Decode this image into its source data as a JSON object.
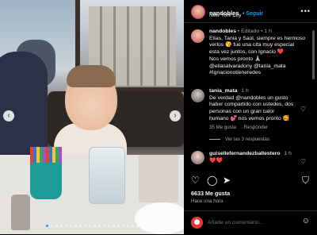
{
  "post": {
    "username": "nandobles",
    "follow_label": "Seguir",
    "location": "New York City",
    "more_label": "•••"
  },
  "comments": [
    {
      "user": "nandobles",
      "edited": "Editado",
      "age": "1 h",
      "text_lines": [
        "Elías, Tania y Saúl, siempre es hermoso",
        "verlos 😘 fue una cita muy especial",
        "esta vez juntos, con Ignacio ❤️",
        "Nos vemos pronto 🙏🏼",
        "@eliasalvaradony @tania_mata",
        "#Ignacionotieneredes"
      ]
    },
    {
      "user": "tania_mata",
      "age": "1 h",
      "text_lines": [
        "De verdad @nandobles un gusto",
        "haber compartido con ustedes, dos",
        "personas con un gran calor",
        "humano 💕 nos vemos pronto 🥰"
      ],
      "likes": "35 Me gusta",
      "reply_label": "Responder",
      "view_replies": "Ver las 3 respuestas"
    },
    {
      "user": "guisellefernandezballestero",
      "age": "1 h",
      "text": "❤️❤️"
    }
  ],
  "footer": {
    "likes": "6633 Me gusta",
    "time_ago": "Hace una hora",
    "add_comment_placeholder": "Añade un comentario..."
  },
  "icons": {
    "heart": "♡",
    "comment": "◯",
    "share": "➤",
    "save": "⛉",
    "emoji": "☺",
    "prev": "‹",
    "next": "›"
  },
  "colors": {
    "link": "#0095f6",
    "accent": "#e1306c",
    "background": "#000000"
  }
}
